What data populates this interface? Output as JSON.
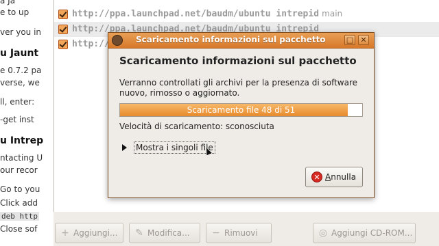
{
  "webpage": {
    "lines": [
      "e to up",
      "ver you in",
      "u Jaunt",
      "e 0.7.2 pa",
      "verse, we",
      "ll, enter:",
      "-get inst",
      "u Intrep",
      "ntacting U",
      "our recor",
      "Go to you",
      "Click add",
      "deb http",
      "Close sof"
    ],
    "top_partial": "a Ja"
  },
  "sources": {
    "repos": [
      {
        "url": "http://ppa.launchpad.net/baudm/ubuntu intrepid",
        "component": "main",
        "checked": true
      },
      {
        "url": "http://ppa.launchpad.net/baudm/ubuntu intrepid",
        "component": "",
        "checked": true
      },
      {
        "url": "http://pp",
        "component": "",
        "checked": true
      }
    ],
    "buttons": {
      "add": "Aggiungi...",
      "edit": "Modifica...",
      "remove": "Rimuovi",
      "add_cdrom": "Aggiungi CD-ROM..."
    }
  },
  "dialog": {
    "title": "Scaricamento informazioni sul pacchetto",
    "heading": "Scaricamento informazioni sul pacchetto",
    "description": "Verranno controllati gli archivi per la presenza di software nuovo, rimosso o aggiornato.",
    "progress_text": "Scaricamento file 48 di 51",
    "progress_fraction": 0.9412,
    "speed_text": "Velocità di scaricamento: sconosciuta",
    "expander_label": "Mostra i singoli file",
    "cancel_label": "Annulla",
    "cancel_mnemonic_rest": "nnulla",
    "cancel_mnemonic_first": "A"
  },
  "colors": {
    "accent": "#e88a2c",
    "titlebar": "#d7782a",
    "cancel_icon": "#d62a22"
  }
}
